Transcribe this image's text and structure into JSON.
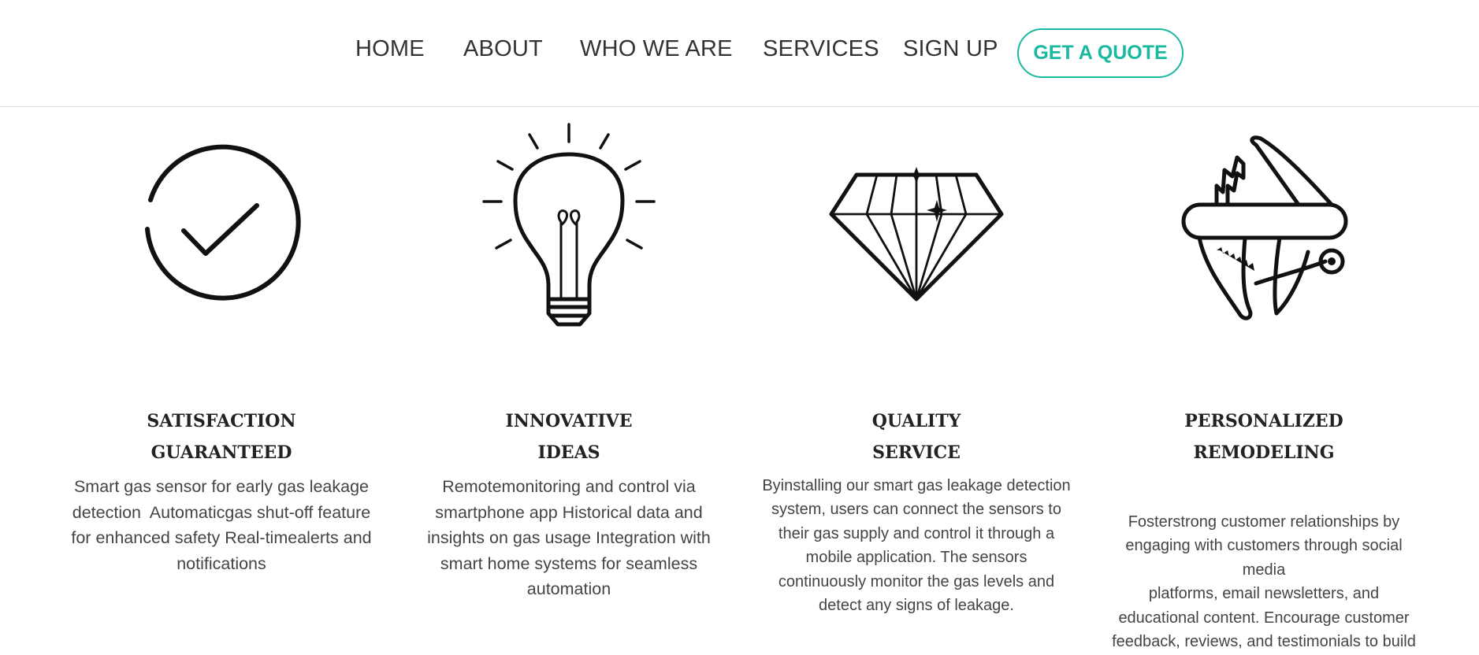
{
  "nav": {
    "items": [
      {
        "label": "HOME"
      },
      {
        "label": "ABOUT"
      },
      {
        "label": "WHO WE ARE"
      },
      {
        "label": "SERVICES"
      },
      {
        "label": "SIGN UP"
      }
    ],
    "cta_label": "GET A QUOTE"
  },
  "colors": {
    "accent": "#19b9a0",
    "text": "#333333",
    "heading": "#222222"
  },
  "features": [
    {
      "icon": "checkmark-circle-icon",
      "title_line1": "SATISFACTION",
      "title_line2": "GUARANTEED",
      "lines": [
        "Smart gas sensor for early gas leakage",
        "detection  Automaticgas shut-off feature",
        "for enhanced safety Real-timealerts and",
        "notifications"
      ]
    },
    {
      "icon": "lightbulb-icon",
      "title_line1": "INNOVATIVE",
      "title_line2": "IDEAS",
      "lines": [
        "Remotemonitoring and control via",
        "smartphone app Historical data and",
        "insights on gas usage Integration with",
        "smart home systems for seamless",
        "automation"
      ]
    },
    {
      "icon": "diamond-icon",
      "title_line1": "QUALITY",
      "title_line2": "SERVICE",
      "lines": [
        "Byinstalling our smart gas leakage detection",
        "system, users can connect the sensors to",
        "their gas supply and control it through a",
        "mobile application. The sensors",
        "continuously monitor the gas levels and",
        "detect any signs of leakage."
      ]
    },
    {
      "icon": "swiss-army-knife-icon",
      "title_line1": "PERSONALIZED",
      "title_line2": "REMODELING",
      "lines": [
        "Fosterstrong customer relationships by",
        "engaging with customers through social",
        "media",
        "platforms, email newsletters, and",
        "educational content. Encourage customer",
        "feedback, reviews, and testimonials to build"
      ]
    }
  ]
}
